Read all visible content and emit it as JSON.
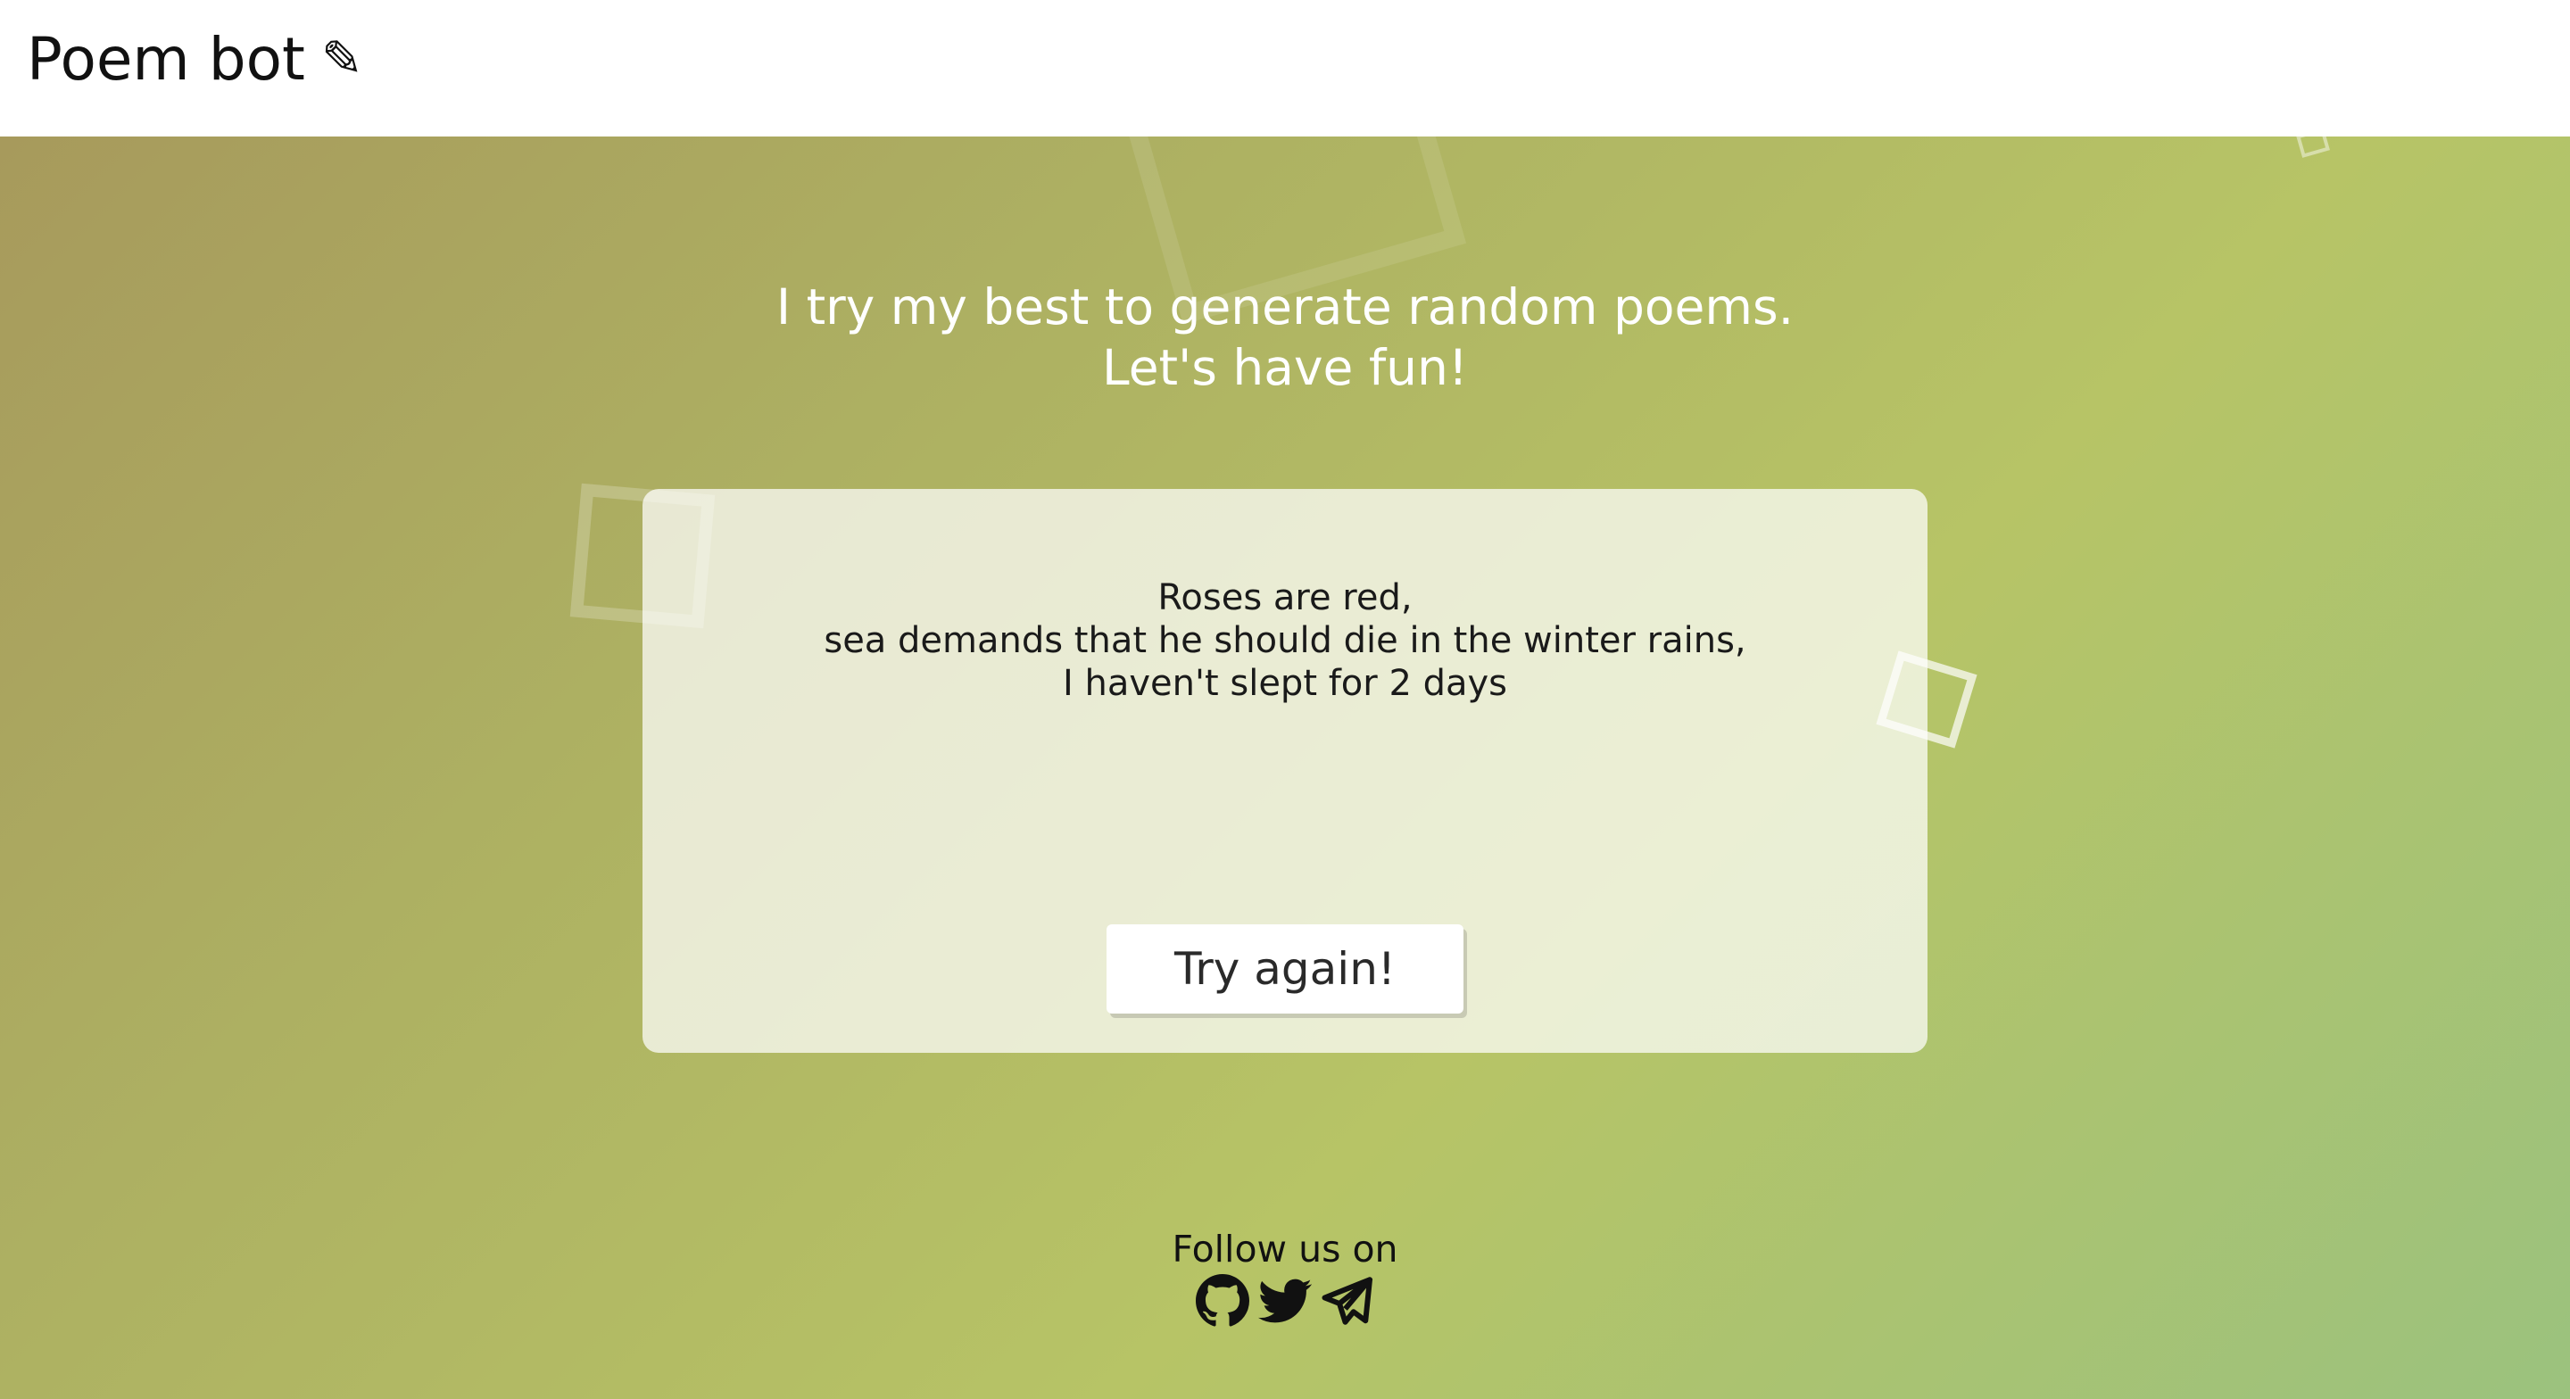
{
  "header": {
    "title": "Poem bot",
    "title_icon": "pencil-icon",
    "title_icon_glyph": "✎"
  },
  "main": {
    "tagline_line1": "I try my best to generate random poems.",
    "tagline_line2": "Let's have fun!",
    "poem": {
      "lines": [
        "Roses are red,",
        "sea demands that he should die in the winter rains,",
        "I haven't slept for 2 days"
      ]
    },
    "try_again_label": "Try again!"
  },
  "footer": {
    "follow_label": "Follow us on",
    "socials": [
      {
        "name": "GitHub",
        "icon": "github-icon"
      },
      {
        "name": "Twitter",
        "icon": "twitter-icon"
      },
      {
        "name": "Telegram",
        "icon": "telegram-icon"
      }
    ]
  },
  "colors": {
    "header_bg": "#ffffff",
    "gradient_start": "#a79a5c",
    "gradient_mid": "#b7c466",
    "gradient_end": "#9bc27e",
    "card_bg": "rgba(255,255,255,0.72)",
    "text_light": "#ffffff",
    "text_dark": "#111111"
  }
}
